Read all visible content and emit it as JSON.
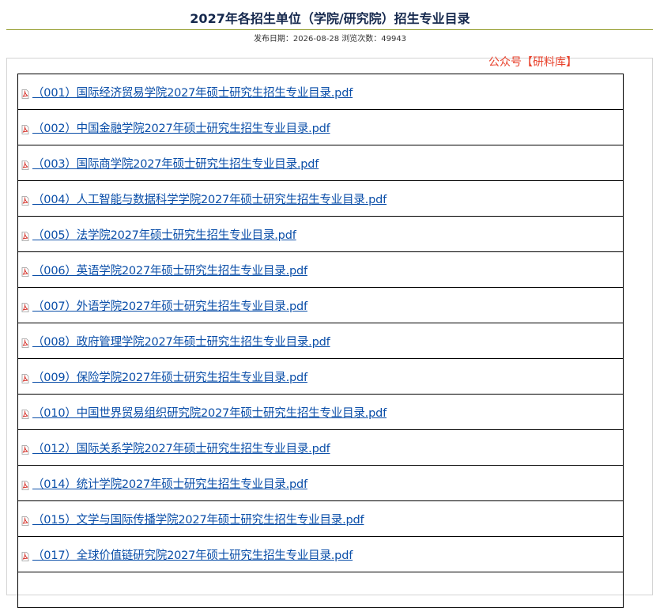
{
  "header": {
    "title": "2027年各招生单位（学院/研究院）招生专业目录",
    "meta": "发布日期：2026-08-28 浏览次数：49943"
  },
  "watermark": "公众号【研料库】",
  "colors": {
    "link": "#0a4ea8",
    "watermark": "#e8412b",
    "title": "#15284d",
    "rule": "#9aa33a"
  },
  "files": [
    {
      "label": "（001）国际经济贸易学院2027年硕士研究生招生专业目录.pdf",
      "icon": "pdf-icon"
    },
    {
      "label": "（002）中国金融学院2027年硕士研究生招生专业目录.pdf",
      "icon": "pdf-icon"
    },
    {
      "label": "（003）国际商学院2027年硕士研究生招生专业目录.pdf",
      "icon": "pdf-icon"
    },
    {
      "label": "（004）人工智能与数据科学学院2027年硕士研究生招生专业目录.pdf",
      "icon": "pdf-icon"
    },
    {
      "label": "（005）法学院2027年硕士研究生招生专业目录.pdf",
      "icon": "pdf-icon"
    },
    {
      "label": "（006）英语学院2027年硕士研究生招生专业目录.pdf",
      "icon": "pdf-icon"
    },
    {
      "label": "（007）外语学院2027年硕士研究生招生专业目录.pdf",
      "icon": "pdf-icon"
    },
    {
      "label": "（008）政府管理学院2027年硕士研究生招生专业目录.pdf",
      "icon": "pdf-icon"
    },
    {
      "label": "（009）保险学院2027年硕士研究生招生专业目录.pdf",
      "icon": "pdf-icon"
    },
    {
      "label": "（010）中国世界贸易组织研究院2027年硕士研究生招生专业目录.pdf",
      "icon": "pdf-icon"
    },
    {
      "label": "（012）国际关系学院2027年硕士研究生招生专业目录.pdf",
      "icon": "pdf-icon"
    },
    {
      "label": "（014）统计学院2027年硕士研究生招生专业目录.pdf",
      "icon": "pdf-icon"
    },
    {
      "label": "（015）文学与国际传播学院2027年硕士研究生招生专业目录.pdf",
      "icon": "pdf-icon"
    },
    {
      "label": "（017）全球价值链研究院2027年硕士研究生招生专业目录.pdf",
      "icon": "pdf-icon"
    },
    {
      "label": "",
      "icon": ""
    }
  ]
}
